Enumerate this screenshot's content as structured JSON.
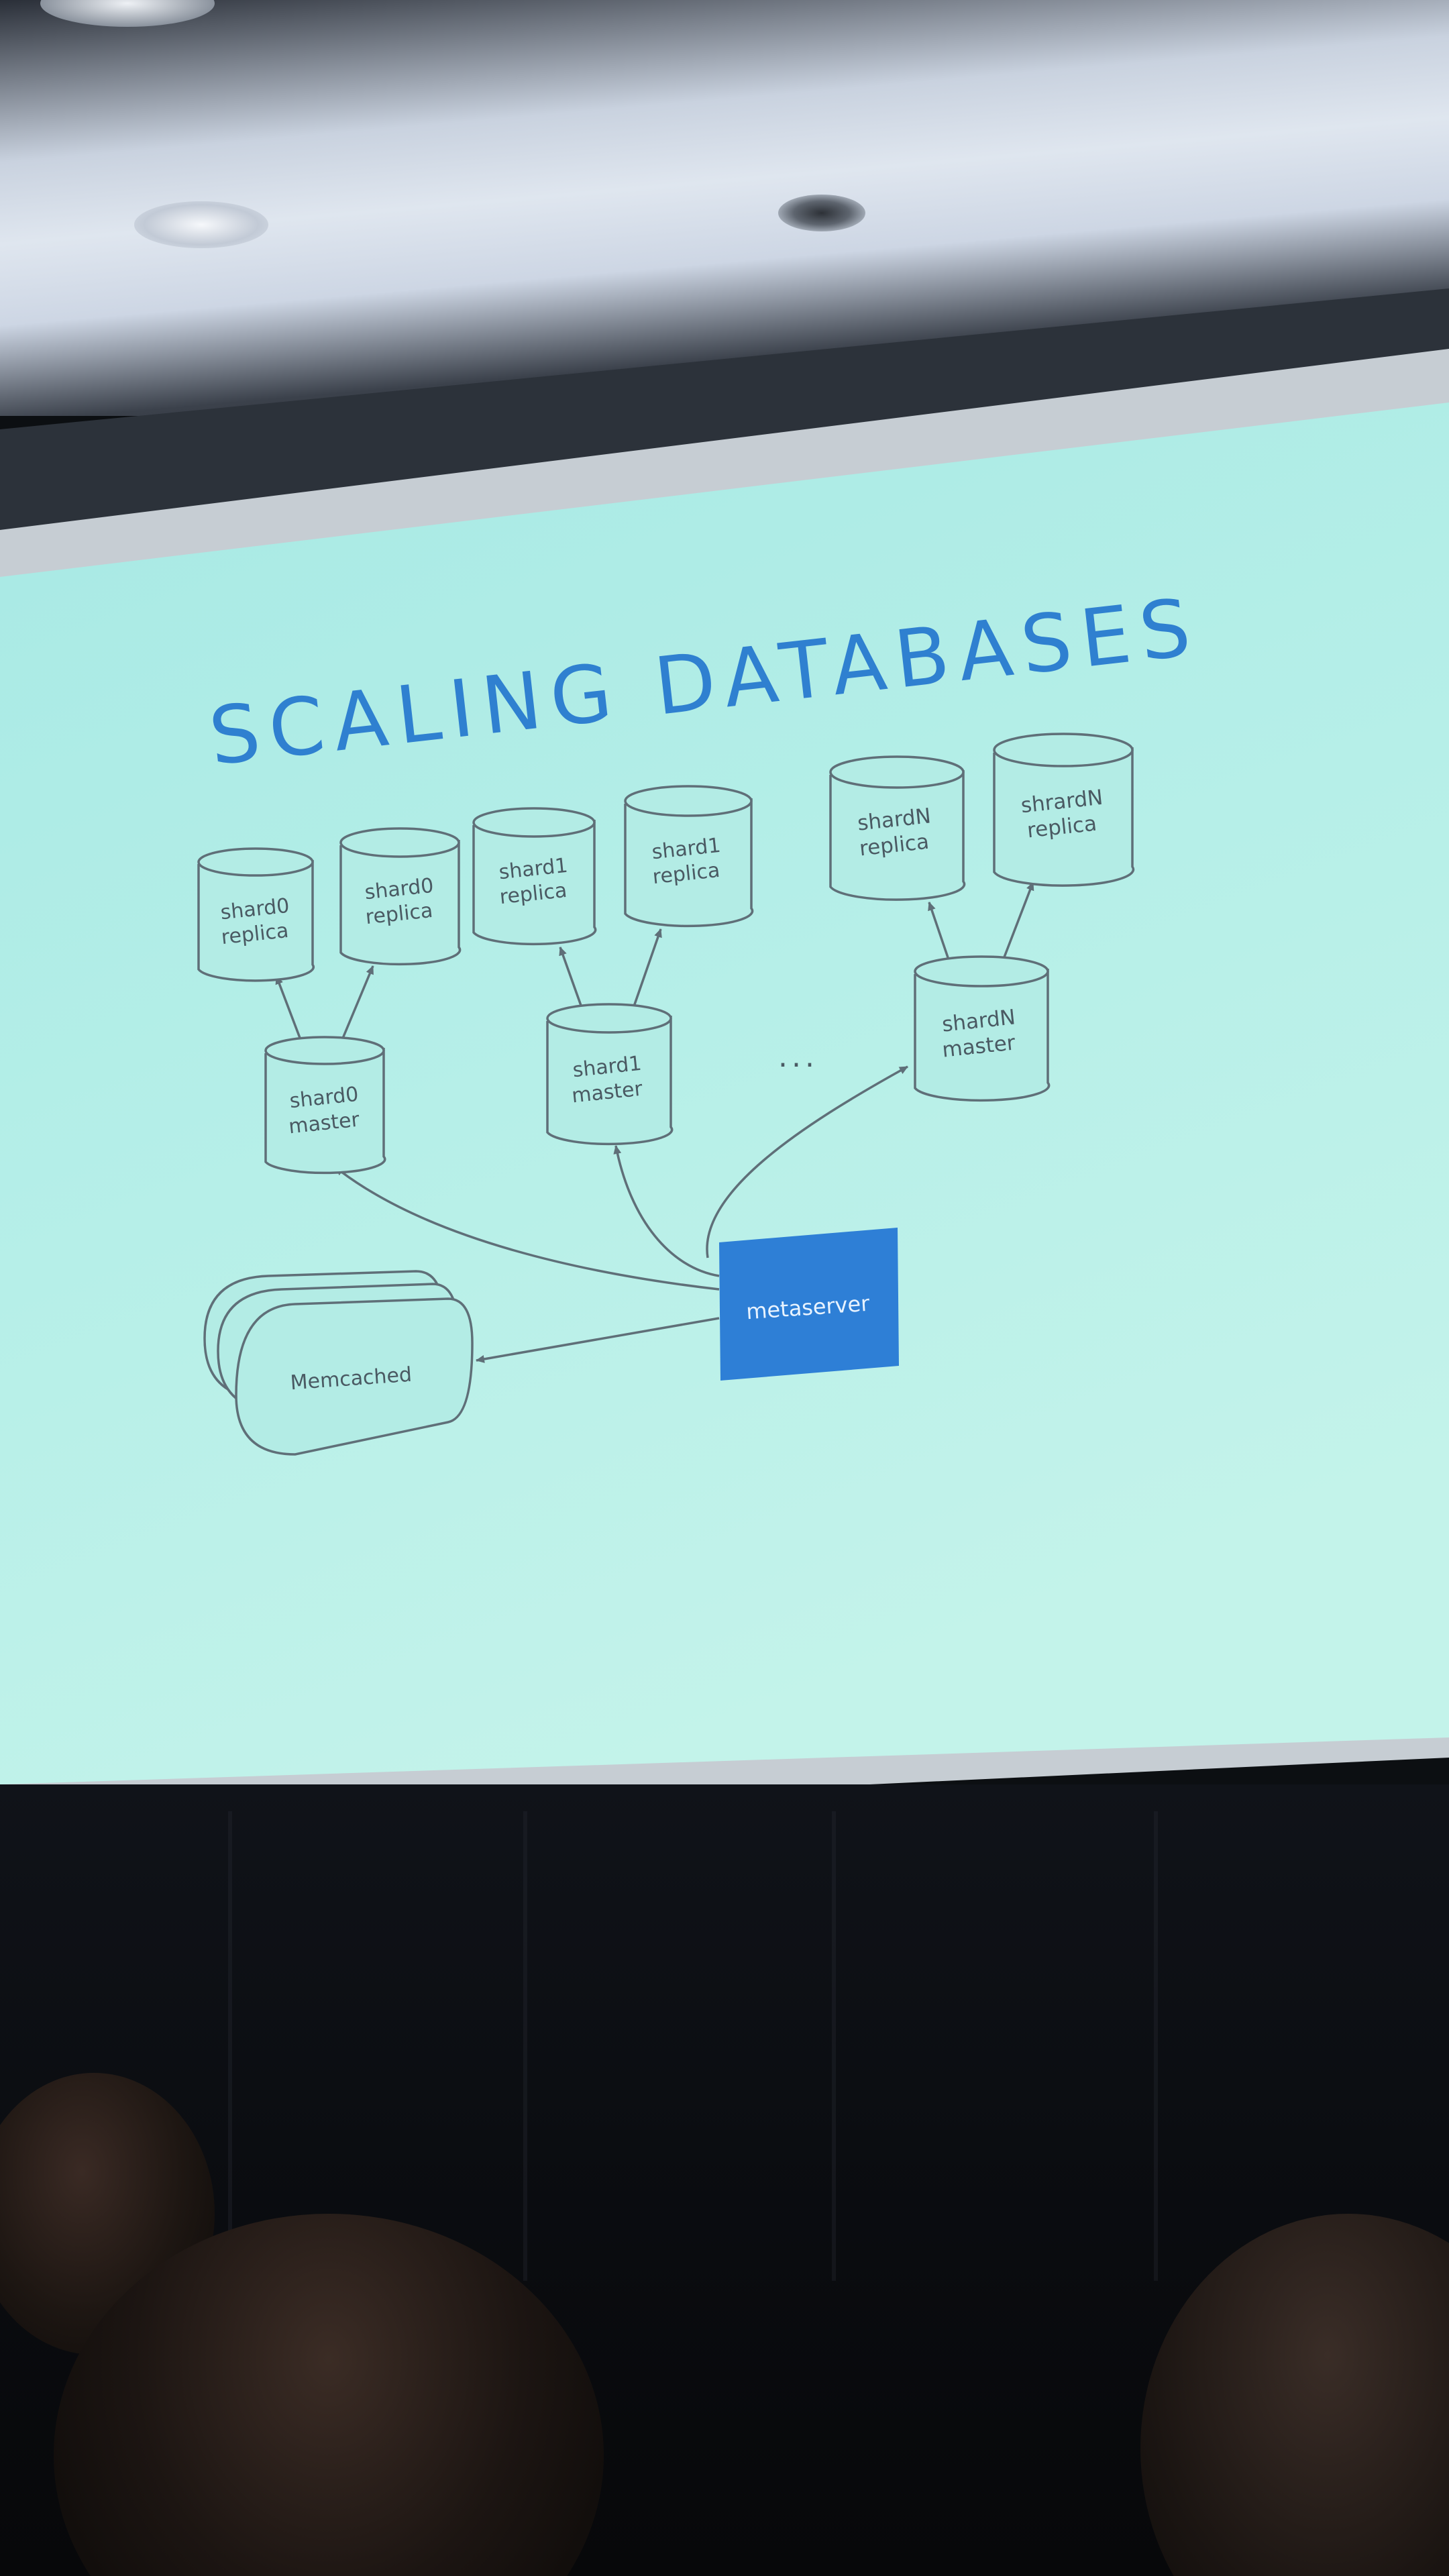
{
  "slide": {
    "title": "SCALING DATABASES",
    "nodes": {
      "shard0_replica_a": [
        "shard0",
        "replica"
      ],
      "shard0_replica_b": [
        "shard0",
        "replica"
      ],
      "shard1_replica_a": [
        "shard1",
        "replica"
      ],
      "shard1_replica_b": [
        "shard1",
        "replica"
      ],
      "shardN_replica_a": [
        "shardN",
        "replica"
      ],
      "shardN_replica_b": [
        "shrardN",
        "replica"
      ],
      "shard0_master": [
        "shard0",
        "master"
      ],
      "shard1_master": [
        "shard1",
        "master"
      ],
      "shardN_master": [
        "shardN",
        "master"
      ],
      "ellipsis": "...",
      "metaserver": "metaserver",
      "memcached": "Memcached"
    },
    "colors": {
      "background": "#b6ede6",
      "title": "#2f80d0",
      "metaserver_fill": "#2e7fd6",
      "metaserver_text": "#e8f3ff",
      "line": "#5f6f78",
      "label": "#4a5a63"
    }
  },
  "scene": {
    "description_icons": [
      "projector-screen",
      "audience-heads",
      "ceiling-lights"
    ]
  }
}
